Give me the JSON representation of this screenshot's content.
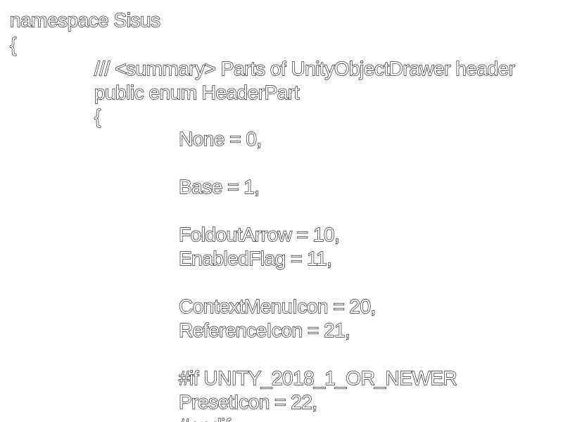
{
  "code": {
    "namespace_line": "namespace Sisus",
    "namespace_open": "{",
    "summary_comment": "/// <summary> Parts of UnityObjectDrawer header",
    "enum_declaration": "public enum HeaderPart",
    "enum_open": "{",
    "member_none": "None = 0,",
    "member_base": "Base = 1,",
    "member_foldout_arrow": "FoldoutArrow = 10,",
    "member_enabled_flag": "EnabledFlag = 11,",
    "member_context_menu_icon": "ContextMenuIcon = 20,",
    "member_reference_icon": "ReferenceIcon = 21,",
    "preprocessor_if": "#if UNITY_2018_1_OR_NEWER",
    "member_preset_icon": "PresetIcon = 22,",
    "preprocessor_endif": "#endif"
  }
}
